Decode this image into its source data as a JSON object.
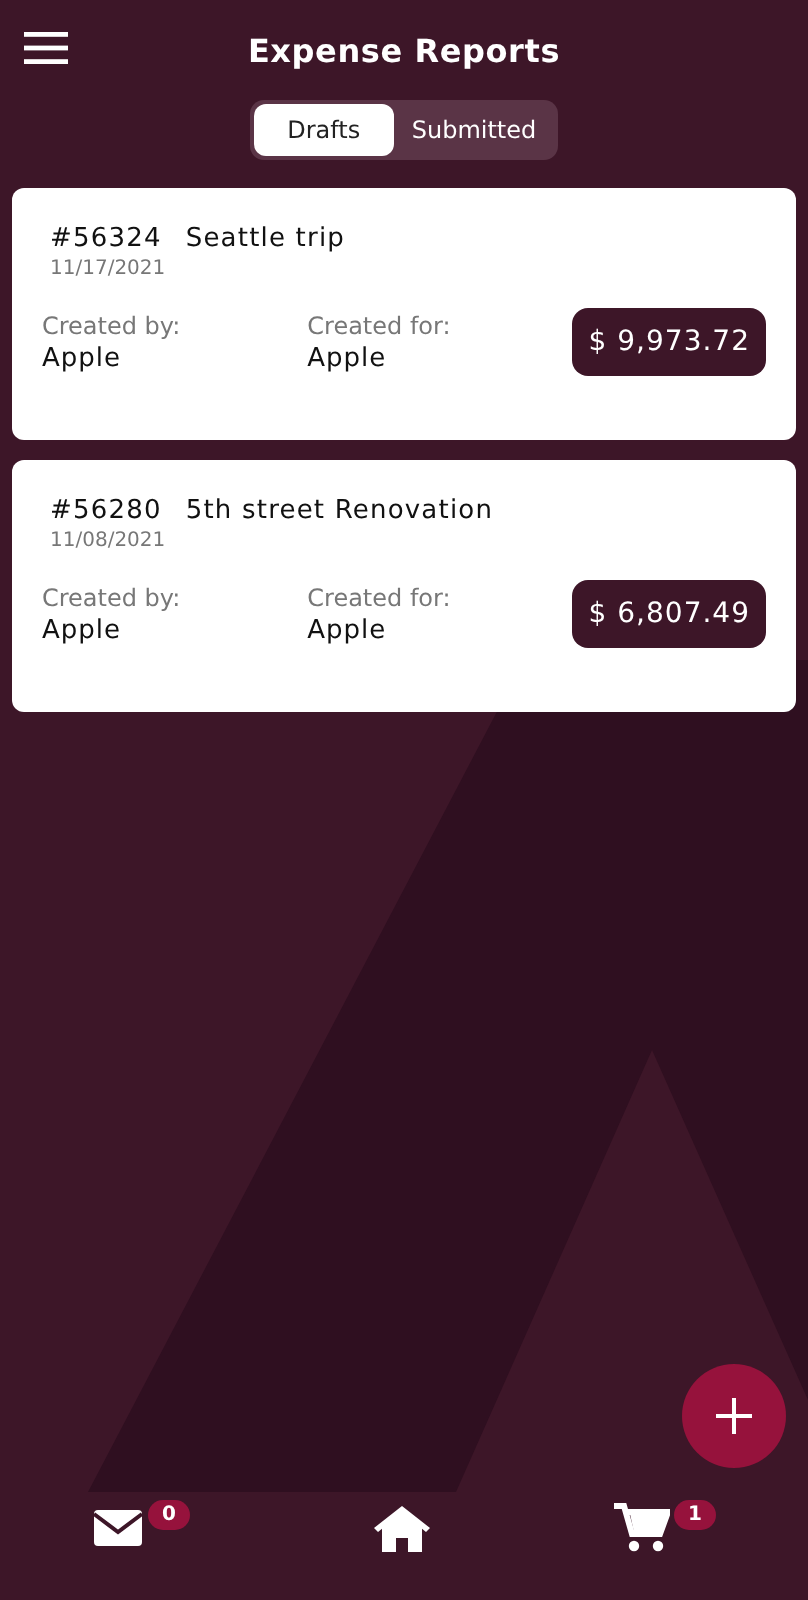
{
  "header": {
    "title": "Expense Reports"
  },
  "tabs": [
    {
      "label": "Drafts",
      "selected": true
    },
    {
      "label": "Submitted",
      "selected": false
    }
  ],
  "reports": [
    {
      "number": "#56324",
      "name": "Seattle trip",
      "date": "11/17/2021",
      "created_by_label": "Created by:",
      "created_by": "Apple",
      "created_for_label": "Created for:",
      "created_for": "Apple",
      "amount": "$ 9,973.72"
    },
    {
      "number": "#56280",
      "name": "5th street Renovation",
      "date": "11/08/2021",
      "created_by_label": "Created by:",
      "created_by": "Apple",
      "created_for_label": "Created for:",
      "created_for": "Apple",
      "amount": "$ 6,807.49"
    }
  ],
  "bottom_nav": [
    {
      "kind": "mail",
      "badge": "0"
    },
    {
      "kind": "home"
    },
    {
      "kind": "cart",
      "badge": "1"
    }
  ]
}
